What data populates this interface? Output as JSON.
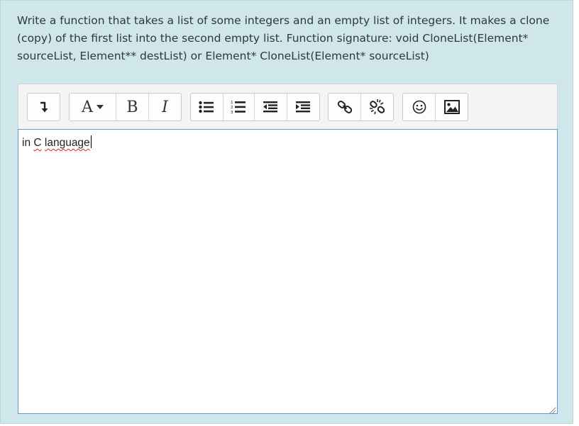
{
  "question": {
    "text": "Write a function that takes a list of some integers and an empty list of integers. It makes a clone (copy) of the first list into the second empty list. Function signature: void CloneList(Element* sourceList, Element** destList) or Element* CloneList(Element* sourceList)"
  },
  "toolbar": {
    "font_label": "A",
    "bold_label": "B",
    "italic_label": "I",
    "icons": [
      "collapse-icon",
      "font-style-icon",
      "bold-icon",
      "italic-icon",
      "unordered-list-icon",
      "ordered-list-icon",
      "outdent-icon",
      "indent-icon",
      "link-icon",
      "unlink-icon",
      "emoji-icon",
      "image-icon"
    ]
  },
  "editor": {
    "text_plain": "in ",
    "text_misspelled_1": "C",
    "text_space": " ",
    "text_misspelled_2": "language"
  },
  "colors": {
    "panel_bg": "#cfe6ea",
    "editor_border_focus": "#5b9bd5",
    "spellcheck": "#d9271f"
  }
}
